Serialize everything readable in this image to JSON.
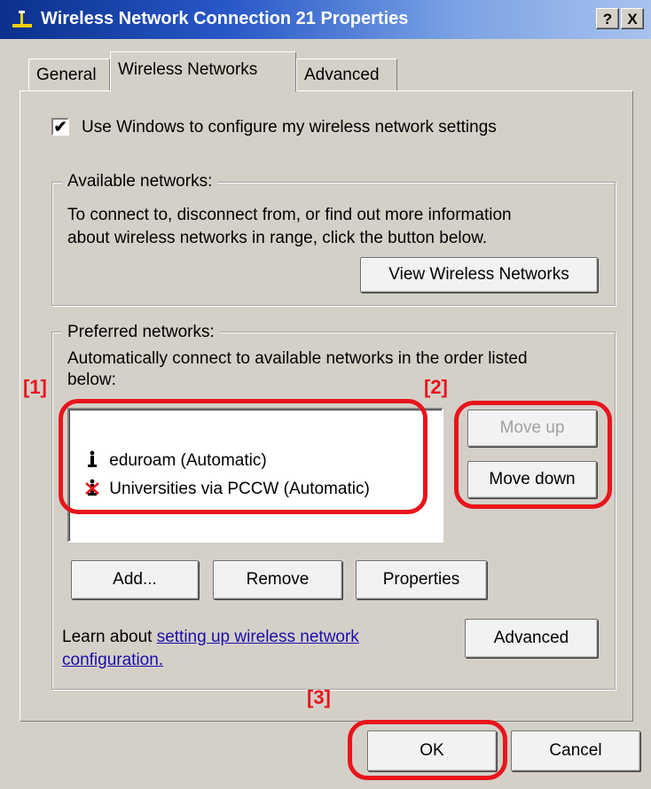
{
  "window": {
    "title": "Wireless Network Connection 21 Properties",
    "help_btn": "?",
    "close_btn": "X"
  },
  "tabs": [
    "General",
    "Wireless Networks",
    "Advanced"
  ],
  "active_tab": "Wireless Networks",
  "use_windows": {
    "checked": true,
    "check_mark": "✔",
    "label": "Use Windows to configure my wireless network settings"
  },
  "available": {
    "legend": "Available networks:",
    "line1": "To connect to, disconnect from, or find out more information",
    "line2": "about wireless networks in range, click the button below.",
    "view_button": "View Wireless Networks"
  },
  "preferred": {
    "legend": "Preferred networks:",
    "line1": "Automatically connect to available networks in the order listed",
    "line2": "below:",
    "networks": [
      {
        "name": "eduroam (Automatic)",
        "icon": "network-antenna-icon"
      },
      {
        "name": "Universities via PCCW (Automatic)",
        "icon": "network-unavailable-icon"
      }
    ],
    "move_up": "Move up",
    "move_down": "Move down",
    "add": "Add...",
    "remove": "Remove",
    "properties": "Properties",
    "learn_text": "Learn about",
    "learn_link1": "setting up wireless network",
    "learn_link2": "configuration.",
    "advanced": "Advanced"
  },
  "callouts": [
    "[1]",
    "[2]",
    "[3]"
  ],
  "footer": {
    "ok": "OK",
    "cancel": "Cancel"
  },
  "colors": {
    "highlight": "#e8141b",
    "title_bar": "#0b2f8c",
    "dialog_face": "#d4d0c8",
    "link": "#1a0dab"
  }
}
